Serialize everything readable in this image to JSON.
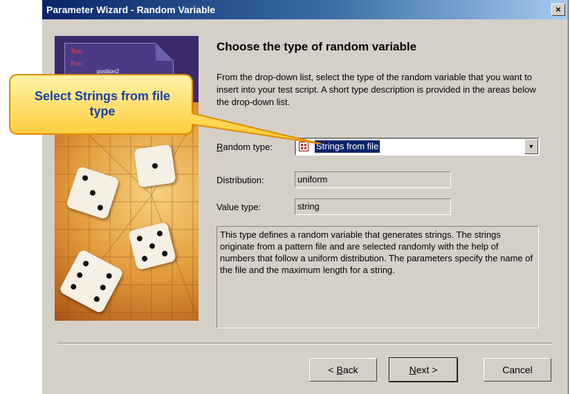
{
  "window": {
    "title": "Parameter Wizard - Random Variable",
    "close_glyph": "×"
  },
  "art": {
    "name1": "Tom:",
    "name2": "Ron:",
    "arrow_label": "position2"
  },
  "main": {
    "heading": "Choose the type of random variable",
    "intro": "From the drop-down list, select the type of the random variable that you want to insert into your test script. A short type description is provided in the areas below the drop-down list."
  },
  "random_type": {
    "label_accel": "R",
    "label_rest": "andom type:",
    "selected": "Strings from file",
    "icon": "dice-list-icon"
  },
  "distribution": {
    "label": "Distribution:",
    "value": "uniform"
  },
  "value_type": {
    "label": "Value type:",
    "value": "string"
  },
  "description": "This type defines a random variable that generates strings. The strings originate from a pattern file and are selected randomly with the help of numbers that follow a uniform distribution. The parameters specify the name of the file and the maximum length for a string.",
  "buttons": {
    "back_prefix": "< ",
    "back_accel": "B",
    "back_rest": "ack",
    "next_accel": "N",
    "next_rest": "ext >",
    "cancel": "Cancel"
  },
  "callout": {
    "text": "Select Strings from file type"
  },
  "colors": {
    "title_bar": "#0a246a",
    "callout_fill": "#ffd24d",
    "callout_text": "#1a3fa8",
    "selection": "#0a246a"
  }
}
